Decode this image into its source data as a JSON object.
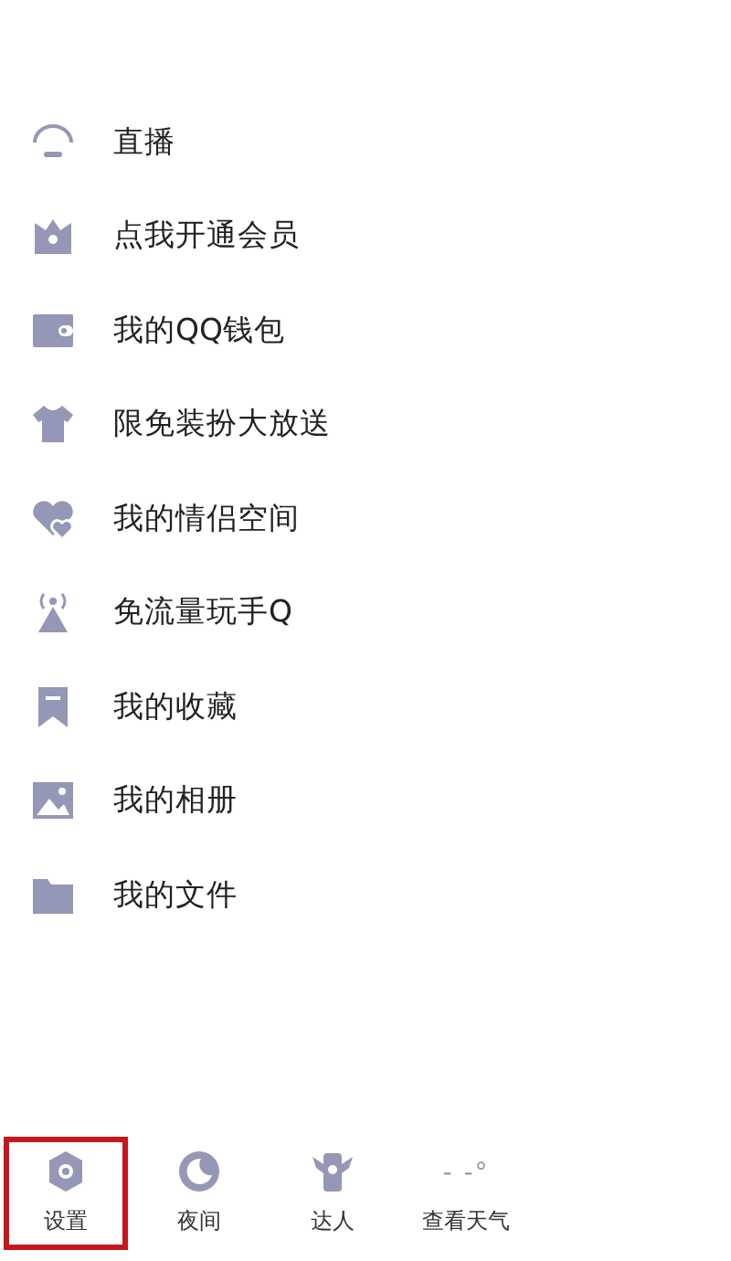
{
  "menu": [
    {
      "label": "直播"
    },
    {
      "label": "点我开通会员"
    },
    {
      "label": "我的QQ钱包"
    },
    {
      "label": "限免装扮大放送"
    },
    {
      "label": "我的情侣空间"
    },
    {
      "label": "免流量玩手Q"
    },
    {
      "label": "我的收藏"
    },
    {
      "label": "我的相册"
    },
    {
      "label": "我的文件"
    }
  ],
  "bottom_bar": [
    {
      "label": "设置",
      "highlighted": true,
      "kind": "icon"
    },
    {
      "label": "夜间",
      "highlighted": false,
      "kind": "icon"
    },
    {
      "label": "达人",
      "highlighted": false,
      "kind": "icon"
    },
    {
      "label": "查看天气",
      "highlighted": false,
      "kind": "weather",
      "reading": "- -°"
    }
  ]
}
